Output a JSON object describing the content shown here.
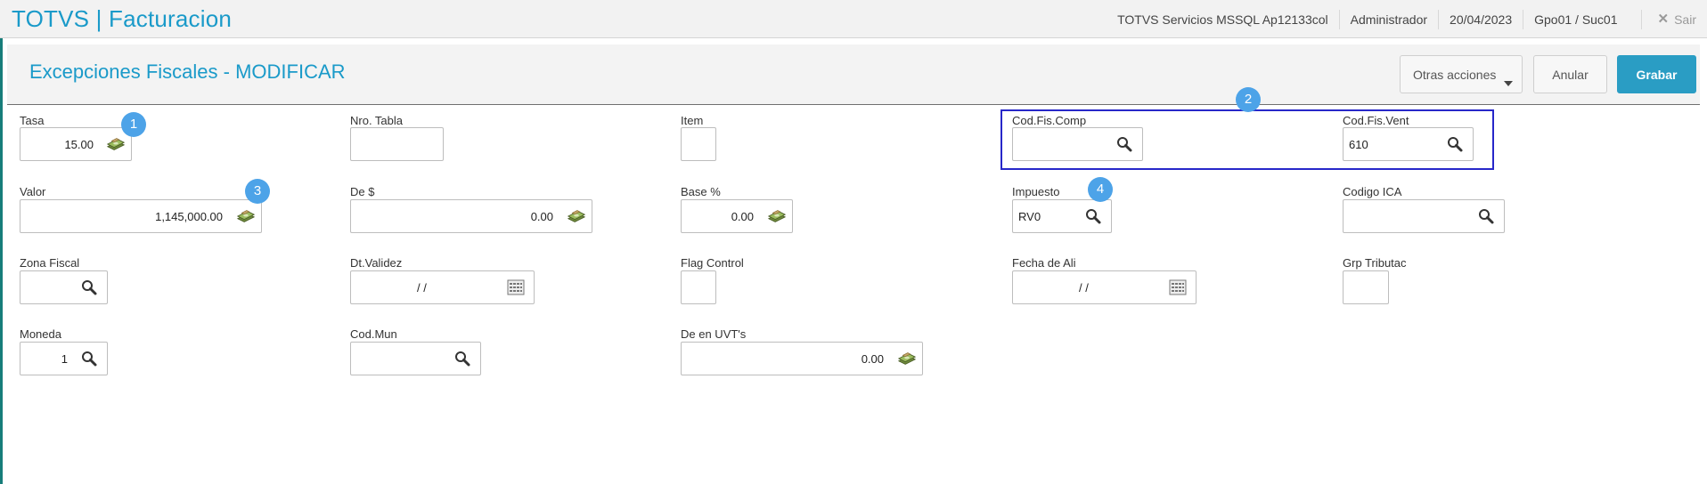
{
  "app": {
    "title": "TOTVS | Facturacion",
    "environment": "TOTVS Servicios MSSQL Ap12133col",
    "user": "Administrador",
    "date": "20/04/2023",
    "branch": "Gpo01 / Suc01",
    "exit_label": "Sair"
  },
  "page": {
    "title": "Excepciones Fiscales - MODIFICAR",
    "actions": {
      "otras": "Otras acciones",
      "anular": "Anular",
      "grabar": "Grabar"
    }
  },
  "form": {
    "tasa": {
      "label": "Tasa",
      "value": "15.00"
    },
    "nro_tabla": {
      "label": "Nro. Tabla",
      "value": ""
    },
    "item": {
      "label": "Item",
      "value": ""
    },
    "cod_fis_comp": {
      "label": "Cod.Fis.Comp",
      "value": ""
    },
    "cod_fis_vent": {
      "label": "Cod.Fis.Vent",
      "value": "610"
    },
    "valor": {
      "label": "Valor",
      "value": "1,145,000.00"
    },
    "de": {
      "label": "De $",
      "value": "0.00"
    },
    "base": {
      "label": "Base %",
      "value": "0.00"
    },
    "impuesto": {
      "label": "Impuesto",
      "value": "RV0"
    },
    "codigo_ica": {
      "label": "Codigo ICA",
      "value": ""
    },
    "zona_fiscal": {
      "label": "Zona Fiscal",
      "value": ""
    },
    "dt_validez": {
      "label": "Dt.Validez",
      "value": "/ /"
    },
    "flag_control": {
      "label": "Flag Control",
      "value": ""
    },
    "fecha_ali": {
      "label": "Fecha de Ali",
      "value": "/ /"
    },
    "grp_tributac": {
      "label": "Grp Tributac",
      "value": ""
    },
    "moneda": {
      "label": "Moneda",
      "value": "1"
    },
    "cod_mun": {
      "label": "Cod.Mun",
      "value": ""
    },
    "de_uvt": {
      "label": "De en UVT's",
      "value": "0.00"
    }
  },
  "annotations": {
    "badge1": "1",
    "badge2": "2",
    "badge3": "3",
    "badge4": "4"
  },
  "colors": {
    "accent": "#1a9ac9",
    "primary_button": "#2a9dc4",
    "highlight_border": "#2727c9",
    "badge": "#4da3e8"
  }
}
